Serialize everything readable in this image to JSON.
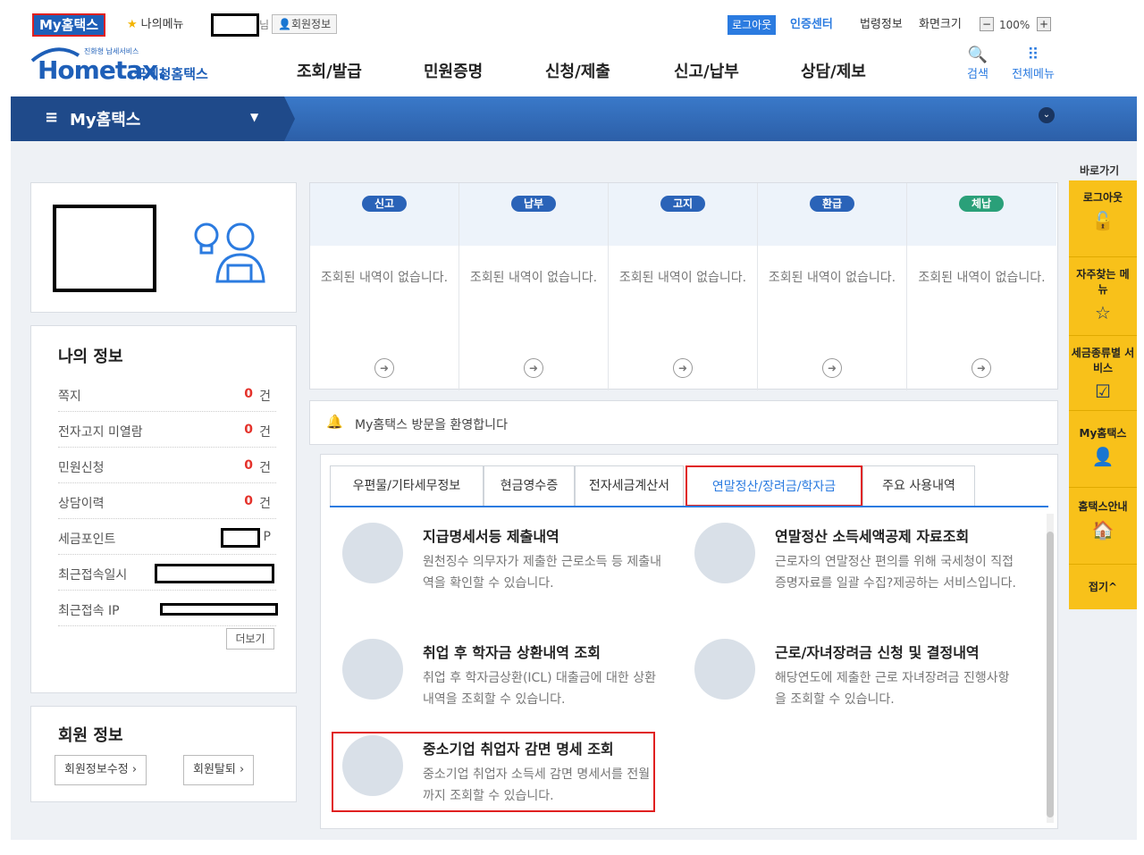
{
  "topbar": {
    "badge": "My홈택스",
    "mymenu": "나의메뉴",
    "nim": "님",
    "member_info": "회원정보",
    "logout": "로그아웃",
    "cert_center": "인증센터",
    "law_info": "법령정보",
    "screen_size": "화면크기",
    "zoom_minus": "−",
    "zoom_value": "100%",
    "zoom_plus": "+"
  },
  "header": {
    "logo_sub": "진화형 납세서비스",
    "logo_main": "Hometax.",
    "logo_kr": "국세청홈택스",
    "nav": [
      "조회/발급",
      "민원증명",
      "신청/제출",
      "신고/납부",
      "상담/제보"
    ],
    "search": "검색",
    "allmenu": "전체메뉴"
  },
  "bluebar": {
    "title": "My홈택스"
  },
  "myinfo": {
    "title": "나의 정보",
    "rows": [
      {
        "label": "쪽지",
        "value": "0",
        "unit": "건"
      },
      {
        "label": "전자고지 미열람",
        "value": "0",
        "unit": "건"
      },
      {
        "label": "민원신청",
        "value": "0",
        "unit": "건"
      },
      {
        "label": "상담이력",
        "value": "0",
        "unit": "건"
      },
      {
        "label": "세금포인트",
        "unit": "P"
      },
      {
        "label": "최근접속일시"
      },
      {
        "label": "최근접속 IP"
      }
    ],
    "more": "더보기"
  },
  "member": {
    "title": "회원 정보",
    "edit": "회원정보수정",
    "withdraw": "회원탈퇴"
  },
  "status": {
    "cols": [
      {
        "badge": "신고",
        "color": "#2a63b8",
        "text": "조회된 내역이 없습니다."
      },
      {
        "badge": "납부",
        "color": "#2a63b8",
        "text": "조회된 내역이 없습니다."
      },
      {
        "badge": "고지",
        "color": "#2a63b8",
        "text": "조회된 내역이 없습니다."
      },
      {
        "badge": "환급",
        "color": "#2a63b8",
        "text": "조회된 내역이 없습니다."
      },
      {
        "badge": "체납",
        "color": "#2aa079",
        "text": "조회된 내역이 없습니다."
      }
    ]
  },
  "welcome": {
    "text": "My홈택스 방문을 환영합니다"
  },
  "tabs": [
    "우편물/기타세무정보",
    "현금영수증",
    "전자세금계산서",
    "연말정산/장려금/학자금",
    "주요 사용내역"
  ],
  "services": [
    {
      "title": "지급명세서등 제출내역",
      "desc": "원천징수 의무자가 제출한 근로소득 등 제출내역을 확인할 수 있습니다."
    },
    {
      "title": "연말정산 소득세액공제 자료조회",
      "desc": "근로자의 연말정산 편의를 위해 국세청이 직접 증명자료를 일괄 수집?제공하는 서비스입니다."
    },
    {
      "title": "취업 후 학자금 상환내역 조회",
      "desc": "취업 후 학자금상환(ICL) 대출금에 대한 상환내역을 조회할 수 있습니다."
    },
    {
      "title": "근로/자녀장려금 신청 및 결정내역",
      "desc": "해당연도에 제출한 근로 자녀장려금 진행사항을 조회할 수 있습니다."
    },
    {
      "title": "중소기업 취업자 감면 명세 조회",
      "desc": "중소기업 취업자 소득세 감면 명세서를 전월까지 조회할 수 있습니다."
    }
  ],
  "quick": {
    "title": "바로가기",
    "items": [
      "로그아웃",
      "자주찾는 메뉴",
      "세금종류별 서비스",
      "My홈택스",
      "홈택스안내"
    ],
    "fold": "접기^"
  },
  "colors": {
    "brand": "#1e5fb8",
    "highlight": "#e02020",
    "quick": "#f8c11a"
  }
}
